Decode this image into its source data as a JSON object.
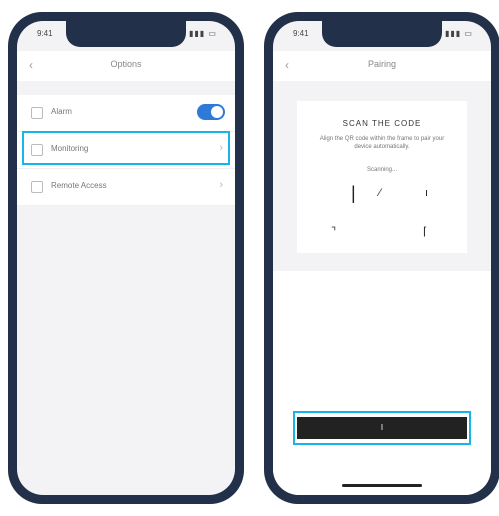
{
  "left_screen": {
    "status": {
      "time": "9:41",
      "signal": "▮▮▮ ▭"
    },
    "title": "Options",
    "back_icon": "back-chevron-icon",
    "items": [
      {
        "label": "Alarm",
        "icon": "alarm-icon",
        "control": "toggle",
        "on": true
      },
      {
        "label": "Monitoring",
        "icon": "monitor-icon",
        "control": "chevron"
      },
      {
        "label": "Remote Access",
        "icon": "remote-icon",
        "control": "chevron"
      }
    ],
    "highlight_color": "#19b4e8",
    "accent": "#2f7ad9"
  },
  "right_screen": {
    "status": {
      "time": "9:41",
      "signal": "▮▮▮ ▭"
    },
    "title": "Pairing",
    "card": {
      "heading": "SCAN THE CODE",
      "description": "Align the QR code within the frame to pair your device automatically.",
      "subtext": "Scanning...",
      "corners": [
        "|",
        "⁄",
        "ı",
        "⌝",
        "⌈"
      ]
    },
    "button": {
      "label": "I"
    },
    "highlight_color": "#19b4e8"
  }
}
